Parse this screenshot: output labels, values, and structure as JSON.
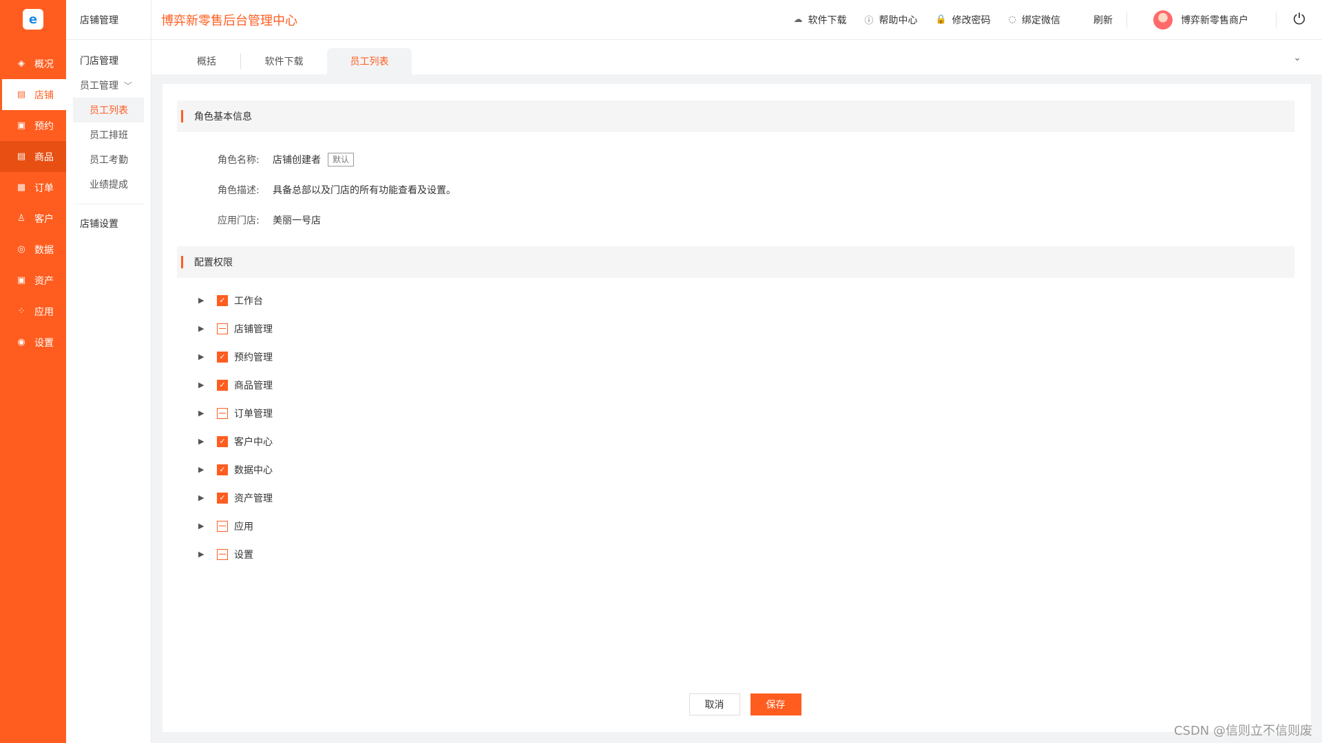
{
  "sidebar": {
    "logo_text": "e",
    "items": [
      {
        "label": "概况",
        "icon": "diamond-icon",
        "glyph": "◈"
      },
      {
        "label": "店铺",
        "icon": "store-icon",
        "glyph": "▤"
      },
      {
        "label": "预约",
        "icon": "calendar-icon",
        "glyph": "▣"
      },
      {
        "label": "商品",
        "icon": "goods-icon",
        "glyph": "▤"
      },
      {
        "label": "订单",
        "icon": "order-icon",
        "glyph": "▦"
      },
      {
        "label": "客户",
        "icon": "user-icon",
        "glyph": "♙"
      },
      {
        "label": "数据",
        "icon": "data-icon",
        "glyph": "◎"
      },
      {
        "label": "资产",
        "icon": "wallet-icon",
        "glyph": "▣"
      },
      {
        "label": "应用",
        "icon": "apps-icon",
        "glyph": "⁘"
      },
      {
        "label": "设置",
        "icon": "settings-icon",
        "glyph": "◉"
      }
    ]
  },
  "subnav": {
    "title": "店铺管理",
    "store_mgmt": "门店管理",
    "staff_mgmt": "员工管理",
    "children": [
      "员工列表",
      "员工排班",
      "员工考勤",
      "业绩提成"
    ],
    "store_settings": "店铺设置"
  },
  "header": {
    "title": "博弈新零售后台管理中心",
    "actions": [
      {
        "label": "软件下载",
        "icon": "cloud-download-icon",
        "glyph": "☁"
      },
      {
        "label": "帮助中心",
        "icon": "help-icon",
        "glyph": "ⓘ"
      },
      {
        "label": "修改密码",
        "icon": "lock-icon",
        "glyph": "🔒"
      },
      {
        "label": "绑定微信",
        "icon": "wechat-icon",
        "glyph": "◌"
      }
    ],
    "refresh": "刷新",
    "user": "博弈新零售商户",
    "power_glyph": "⏻"
  },
  "tabs": [
    "概括",
    "软件下载",
    "员工列表"
  ],
  "collapse_glyph": "⌄",
  "role_section": {
    "title": "角色基本信息",
    "name_label": "角色名称:",
    "name_value": "店铺创建者",
    "name_tag": "默认",
    "desc_label": "角色描述:",
    "desc_value": "具备总部以及门店的所有功能查看及设置。",
    "store_label": "应用门店:",
    "store_value": "美丽一号店"
  },
  "perm_section": {
    "title": "配置权限",
    "items": [
      {
        "label": "工作台",
        "state": "checked"
      },
      {
        "label": "店铺管理",
        "state": "partial"
      },
      {
        "label": "预约管理",
        "state": "checked"
      },
      {
        "label": "商品管理",
        "state": "checked"
      },
      {
        "label": "订单管理",
        "state": "partial"
      },
      {
        "label": "客户中心",
        "state": "checked"
      },
      {
        "label": "数据中心",
        "state": "checked"
      },
      {
        "label": "资产管理",
        "state": "checked"
      },
      {
        "label": "应用",
        "state": "partial"
      },
      {
        "label": "设置",
        "state": "partial"
      }
    ]
  },
  "buttons": {
    "cancel": "取消",
    "save": "保存"
  },
  "watermark": "CSDN @信则立不信则废",
  "colors": {
    "accent": "#ff5d1f",
    "bg": "#f2f3f5"
  }
}
